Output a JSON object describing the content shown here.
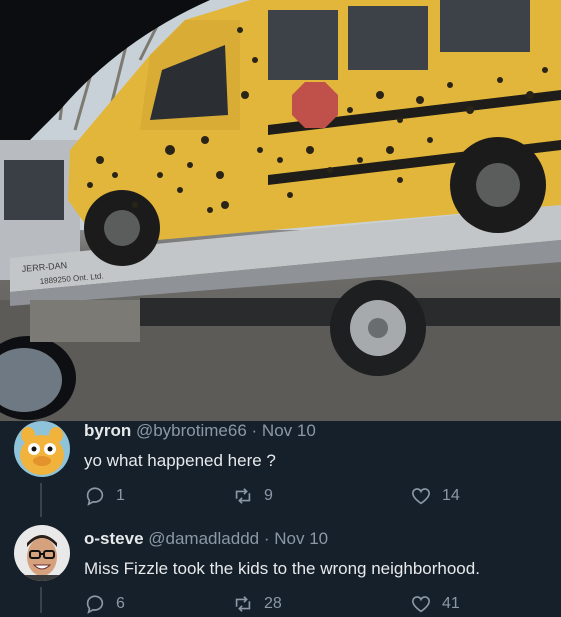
{
  "photo": {
    "truck_text_brand": "JERR-DAN",
    "truck_text_sub": "1889250 Ont. Ltd."
  },
  "tweets": [
    {
      "display_name": "byron",
      "handle": "@bybrotime66",
      "separator": "·",
      "date": "Nov 10",
      "text": "yo what happened here ?",
      "reply_count": "1",
      "retweet_count": "9",
      "like_count": "14"
    },
    {
      "display_name": "o-steve",
      "handle": "@damadladdd",
      "separator": "·",
      "date": "Nov 10",
      "text": "Miss Fizzle took the kids to the wrong neighborhood.",
      "reply_count": "6",
      "retweet_count": "28",
      "like_count": "41"
    }
  ],
  "icons": {
    "reply": "reply-icon",
    "retweet": "retweet-icon",
    "like": "heart-icon"
  },
  "colors": {
    "background": "#15202b",
    "text": "#e7e9ea",
    "muted": "#8b98a5",
    "bus_yellow": "#e2b63a"
  }
}
